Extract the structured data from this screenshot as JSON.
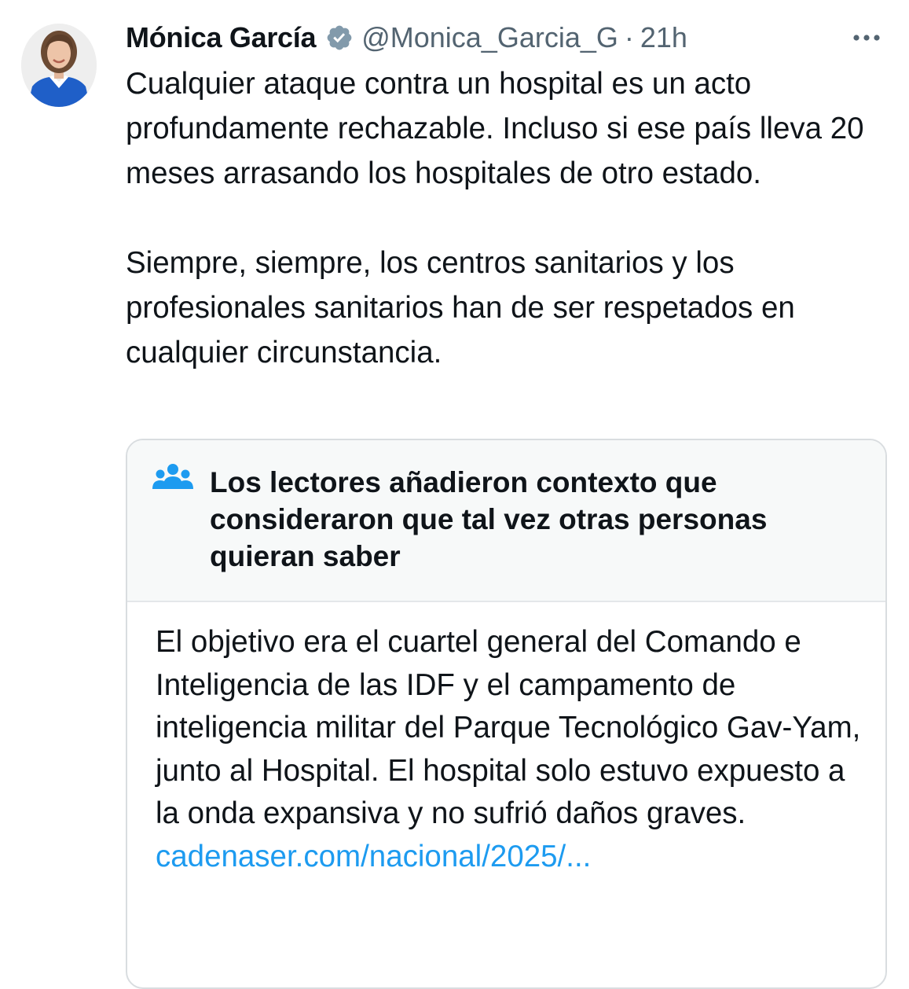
{
  "tweet": {
    "author_name": "Mónica García",
    "handle": "@Monica_Garcia_G",
    "separator": "·",
    "time": "21h",
    "text": "Cualquier ataque contra un hospital es un acto profundamente rechazable. Incluso si ese país lleva 20 meses arrasando los hospitales de otro estado.\n\nSiempre, siempre, los centros sanitarios y los profesionales sanitarios han de ser respetados en cualquier circunstancia."
  },
  "icons": {
    "avatar": "avatar-photo",
    "verified": "verified-badge-icon",
    "more": "more-options-icon",
    "community": "community-notes-icon"
  },
  "community_note": {
    "title": "Los lectores añadieron contexto que consideraron que tal vez otras personas quieran saber",
    "body": "El objetivo era el cuartel general del Comando e Inteligencia de las IDF y el campamento de inteligencia militar del Parque Tecnológico Gav-Yam, junto al Hospital. El hospital solo estuvo expuesto a la onda expansiva y no sufrió daños graves.",
    "link_text": "cadenaser.com/nacional/2025/..."
  },
  "colors": {
    "text_primary": "#0f1419",
    "text_secondary": "#536471",
    "link": "#1d9bf0",
    "note_header_bg": "#f7f9f9",
    "border": "#d9dde0"
  }
}
